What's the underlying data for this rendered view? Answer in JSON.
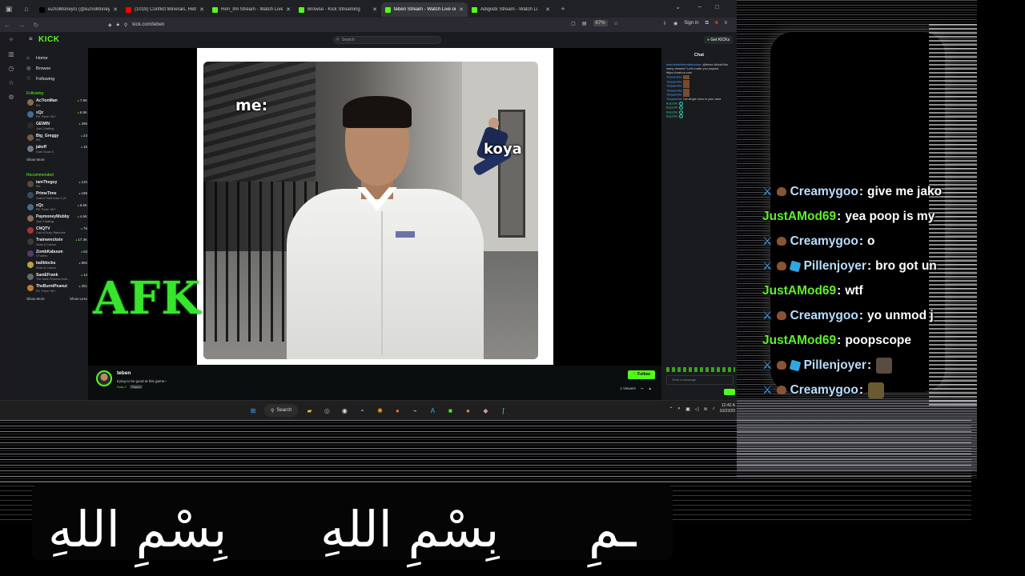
{
  "browser": {
    "tabs": [
      {
        "title": "eZnoMoneyG (@eZnoMoneyG",
        "color": "#000000"
      },
      {
        "title": "(1019) Conflict Minerals, Rebel",
        "color": "#ff0000"
      },
      {
        "title": "Ren_lml Stream - Watch Live on",
        "color": "#53fc18"
      },
      {
        "title": "Browse - Kick Streaming",
        "color": "#53fc18"
      },
      {
        "title": "teben Stream - Watch Live on K",
        "color": "#53fc18",
        "active": true
      },
      {
        "title": "Adigodx Stream - Watch Li",
        "color": "#53fc18"
      }
    ],
    "url": "kick.com/teben",
    "zoom": "67%",
    "sign_in": "Sign in"
  },
  "kick": {
    "logo": "KICK",
    "search_placeholder": "Search",
    "get_kicks": "Get KICKs",
    "nav": [
      {
        "label": "Home",
        "icon": "home-icon"
      },
      {
        "label": "Browse",
        "icon": "browse-icon"
      },
      {
        "label": "Following",
        "icon": "heart-icon"
      }
    ],
    "following_header": "Following",
    "following": [
      {
        "name": "Ac7ionMan",
        "game": "IRL",
        "viewers": "7.9K",
        "color": "#8b6b4a"
      },
      {
        "name": "xQc",
        "game": "RV There Yet?",
        "viewers": "6.5K",
        "color": "#4a6b8b"
      },
      {
        "name": "GEWIN",
        "game": "Just Chatting",
        "viewers": "266",
        "color": "#2b2b2b"
      },
      {
        "name": "Big_Greggy",
        "game": "IRL",
        "viewers": "23",
        "color": "#7a5a3a"
      },
      {
        "name": "jakeff",
        "game": "Dark Souls II",
        "viewers": "16",
        "color": "#6a7a8a"
      }
    ],
    "show_more": "Show More",
    "recommended_header": "Recommended",
    "recommended": [
      {
        "name": "iamTheguy",
        "game": "IRL",
        "viewers": "120",
        "color": "#5a4a3a"
      },
      {
        "name": "PrimeTime",
        "game": "Grand Theft Auto V (G",
        "viewers": "186",
        "color": "#3a4a5a"
      },
      {
        "name": "xQc",
        "game": "RV There Yet?",
        "viewers": "6.5K",
        "color": "#4a6b8b"
      },
      {
        "name": "PaymoneyWubby",
        "game": "Just Chatting",
        "viewers": "4.6K",
        "color": "#8a6a5a"
      },
      {
        "name": "CNQTV",
        "game": "Call of Duty: Warzone",
        "viewers": "76",
        "color": "#aa3333"
      },
      {
        "name": "Trainwreckstv",
        "game": "Slots & Casino",
        "viewers": "17.3K",
        "color": "#3a3a3a"
      },
      {
        "name": "ZombKabuum",
        "game": "VTubers",
        "viewers": "53",
        "color": "#5a3a6a"
      },
      {
        "name": "ballblocks",
        "game": "Slots & Casino",
        "viewers": "982",
        "color": "#c0a040"
      },
      {
        "name": "SamEFrank",
        "game": "The Dark Pictures Anth...",
        "viewers": "14",
        "color": "#6a6a6a"
      },
      {
        "name": "TheBurntPeanut",
        "game": "RV There Yet?",
        "viewers": "351",
        "color": "#c07a30"
      }
    ],
    "show_more_2": "Show More",
    "show_less": "Show Less"
  },
  "video": {
    "meme_me": "me:",
    "meme_koya": "koya",
    "afk": "AFK"
  },
  "stream": {
    "name": "teben",
    "title": "trying to be good at this game~",
    "category": "Dota 2",
    "tag": "Filipino",
    "follow": "Follow",
    "viewers": "1 Viewers"
  },
  "chat": {
    "title": "Chat",
    "lines": [
      {
        "user": "beardeddelbrenaltsmdrop",
        "text": ": @teben Would like many viewers? Let's make you popular https://naziruo.com",
        "type": "text"
      },
      {
        "user": "TonyanoNe",
        "text": ":",
        "type": "emote"
      },
      {
        "user": "TonyanoNe",
        "text": ":",
        "type": "emote"
      },
      {
        "user": "TonyanoNe",
        "text": ":",
        "type": "emote"
      },
      {
        "user": "TonyanoNe",
        "text": ":",
        "type": "emote"
      },
      {
        "user": "TonyanoNe",
        "text": ":",
        "type": "emote"
      },
      {
        "user": "TonyanoNe",
        "text": ": hot single mom in your area",
        "type": "text"
      },
      {
        "user": "Bojo20k",
        "text": ":",
        "type": "g"
      },
      {
        "user": "Bojo20k",
        "text": ":",
        "type": "g"
      },
      {
        "user": "Bojo20k",
        "text": ":",
        "type": "g"
      },
      {
        "user": "Bojo20k",
        "text": ":",
        "type": "g"
      }
    ],
    "placeholder": "Send a message"
  },
  "taskbar": {
    "search": "Search",
    "time": "12:42 A",
    "date": "10/23/20"
  },
  "overlay_chat": [
    {
      "user": "Creamygoo",
      "msg": "give me jako",
      "mod_badge": true,
      "poop": true,
      "cube": false,
      "mod": false,
      "emote": ""
    },
    {
      "user": "JustAMod69",
      "msg": "yea poop is my",
      "mod_badge": false,
      "poop": false,
      "cube": false,
      "mod": true,
      "emote": ""
    },
    {
      "user": "Creamygoo",
      "msg": "o",
      "mod_badge": true,
      "poop": true,
      "cube": false,
      "mod": false,
      "emote": ""
    },
    {
      "user": "Pillenjoyer",
      "msg": "bro got un",
      "mod_badge": true,
      "poop": true,
      "cube": true,
      "mod": false,
      "emote": ""
    },
    {
      "user": "JustAMod69",
      "msg": "wtf",
      "mod_badge": false,
      "poop": false,
      "cube": false,
      "mod": true,
      "emote": ""
    },
    {
      "user": "Creamygoo",
      "msg": "yo unmod j",
      "mod_badge": true,
      "poop": true,
      "cube": false,
      "mod": false,
      "emote": ""
    },
    {
      "user": "JustAMod69",
      "msg": "poopscope",
      "mod_badge": false,
      "poop": false,
      "cube": false,
      "mod": true,
      "emote": ""
    },
    {
      "user": "Pillenjoyer",
      "msg": "",
      "mod_badge": true,
      "poop": true,
      "cube": true,
      "mod": false,
      "emote": "#5a4a40"
    },
    {
      "user": "Creamygoo",
      "msg": "",
      "mod_badge": true,
      "poop": true,
      "cube": false,
      "mod": false,
      "emote": "#6a5a30"
    }
  ],
  "arabic": {
    "p1": "بِسْمِ اللهِ",
    "p2": "بِسْمِ اللهِ",
    "p3": "ـمِ"
  },
  "colors": {
    "kick_green": "#53fc18",
    "mod_blue": "#4fb3ff"
  }
}
